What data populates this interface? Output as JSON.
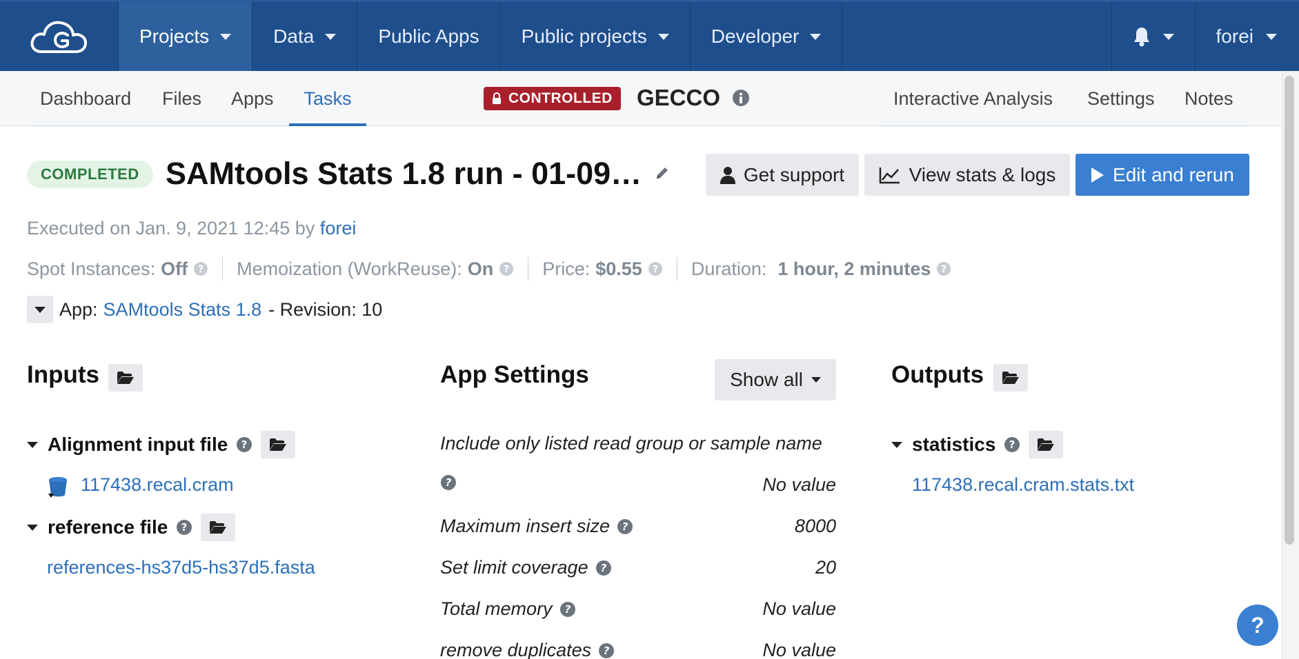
{
  "topnav": {
    "items": [
      {
        "label": "Projects",
        "dropdown": true,
        "active": true
      },
      {
        "label": "Data",
        "dropdown": true
      },
      {
        "label": "Public Apps",
        "dropdown": false
      },
      {
        "label": "Public projects",
        "dropdown": true
      },
      {
        "label": "Developer",
        "dropdown": true
      }
    ],
    "user": "forei",
    "icons": {
      "logo": "cloud-logo-icon",
      "notifications": "bell-icon"
    }
  },
  "subnav": {
    "tabs": [
      {
        "label": "Dashboard"
      },
      {
        "label": "Files"
      },
      {
        "label": "Apps"
      },
      {
        "label": "Tasks",
        "active": true
      }
    ],
    "badge": "CONTROLLED",
    "project_name": "GECCO",
    "right_links": [
      {
        "label": "Interactive Analysis"
      },
      {
        "label": "Settings"
      },
      {
        "label": "Notes"
      }
    ]
  },
  "task": {
    "status": "COMPLETED",
    "title": "SAMtools Stats 1.8 run - 01-09…",
    "buttons": {
      "support": "Get support",
      "stats": "View stats & logs",
      "rerun": "Edit and rerun"
    },
    "executed_prefix": "Executed on Jan. 9, 2021 12:45 by",
    "executed_user": "forei",
    "meta": {
      "spot_label": "Spot Instances:",
      "spot_value": "Off",
      "memo_label": "Memoization (WorkReuse):",
      "memo_value": "On",
      "price_label": "Price:",
      "price_value": "$0.55",
      "duration_label": "Duration:",
      "duration_value": "1 hour, 2 minutes"
    },
    "app": {
      "prefix": "App:",
      "name": "SAMtools Stats 1.8",
      "revision": "- Revision: 10"
    }
  },
  "inputs": {
    "title": "Inputs",
    "groups": [
      {
        "label": "Alignment input file",
        "file": "117438.recal.cram"
      },
      {
        "label": "reference file",
        "file": "references-hs37d5-hs37d5.fasta"
      }
    ]
  },
  "settings": {
    "title": "App Settings",
    "show_all": "Show all",
    "rows": [
      {
        "label": "Include only listed read group or sample name",
        "value": ""
      },
      {
        "label": "",
        "value": "No value"
      },
      {
        "label": "Maximum insert size",
        "value": "8000"
      },
      {
        "label": "Set limit coverage",
        "value": "20"
      },
      {
        "label": "Total memory",
        "value": "No value"
      },
      {
        "label": "remove duplicates",
        "value": "No value"
      }
    ]
  },
  "outputs": {
    "title": "Outputs",
    "groups": [
      {
        "label": "statistics",
        "file": "117438.recal.cram.stats.txt"
      }
    ]
  },
  "help": "?",
  "colors": {
    "nav_bg": "#1f4e8c",
    "accent": "#2c6fb8",
    "primary_button": "#3a7fd1",
    "controlled_badge": "#a8202b",
    "completed_badge_bg": "#e3f4e7",
    "completed_badge_text": "#2c7a3f"
  }
}
